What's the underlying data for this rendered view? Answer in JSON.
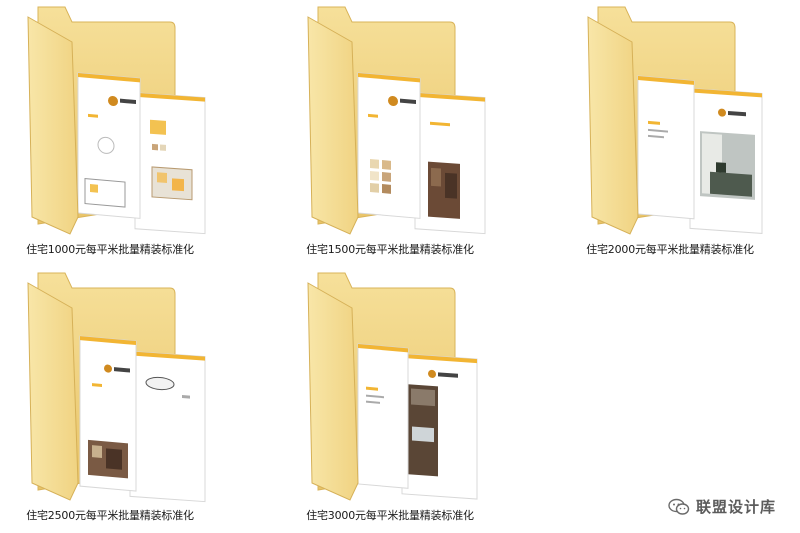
{
  "folders": [
    {
      "name": "住宅1000元每平米批量精装标准化",
      "preview_icon": "folder-with-floorplan-docs-icon"
    },
    {
      "name": "住宅1500元每平米批量精装标准化",
      "preview_icon": "folder-with-material-swatches-icon"
    },
    {
      "name": "住宅2000元每平米批量精装标准化",
      "preview_icon": "folder-with-interior-photo-docs-icon"
    },
    {
      "name": "住宅2500元每平米批量精装标准化",
      "preview_icon": "folder-with-floorplan-docs-icon"
    },
    {
      "name": "住宅3000元每平米批量精装标准化",
      "preview_icon": "folder-with-interior-photo-docs-icon"
    }
  ],
  "watermark": {
    "text": "联盟设计库",
    "icon": "wechat-icon"
  },
  "colors": {
    "folder_back": "#f3d98a",
    "folder_front": "#f7e3a2",
    "doc_stripe": "#f2b533",
    "background": "#ffffff"
  }
}
